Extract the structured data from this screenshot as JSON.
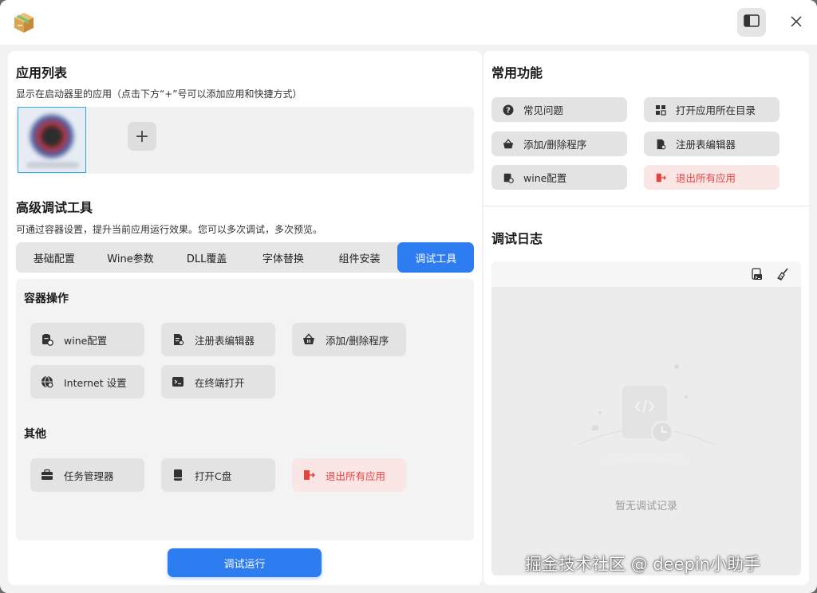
{
  "window": {
    "app_icon": "package-box-icon",
    "sidebar_toggle_icon": "sidebar-toggle-icon",
    "close_icon": "close-icon"
  },
  "left": {
    "app_list": {
      "title": "应用列表",
      "description": "显示在启动器里的应用（点击下方“+”号可以添加应用和快捷方式）",
      "add_label": "+"
    },
    "debug_tools": {
      "title": "高级调试工具",
      "description": "可通过容器设置，提升当前应用运行效果。您可以多次调试，多次预览。",
      "tabs": [
        {
          "label": "基础配置"
        },
        {
          "label": "Wine参数"
        },
        {
          "label": "DLL覆盖"
        },
        {
          "label": "字体替换"
        },
        {
          "label": "组件安装"
        },
        {
          "label": "调试工具"
        }
      ],
      "active_tab": 5
    },
    "container_ops": {
      "title": "容器操作",
      "buttons": [
        {
          "label": "wine配置",
          "icon": "wine-config-icon"
        },
        {
          "label": "注册表编辑器",
          "icon": "registry-editor-icon"
        },
        {
          "label": "添加/删除程序",
          "icon": "basket-icon"
        },
        {
          "label": "Internet 设置",
          "icon": "globe-icon"
        },
        {
          "label": "在终端打开",
          "icon": "terminal-icon"
        }
      ]
    },
    "others": {
      "title": "其他",
      "buttons": [
        {
          "label": "任务管理器",
          "icon": "toolbox-icon"
        },
        {
          "label": "打开C盘",
          "icon": "drive-icon"
        },
        {
          "label": "退出所有应用",
          "icon": "exit-icon"
        }
      ]
    },
    "run_button": "调试运行"
  },
  "right": {
    "common": {
      "title": "常用功能",
      "buttons": [
        {
          "label": "常见问题",
          "icon": "question-icon"
        },
        {
          "label": "打开应用所在目录",
          "icon": "folder-grid-icon"
        },
        {
          "label": "添加/删除程序",
          "icon": "basket-icon"
        },
        {
          "label": "注册表编辑器",
          "icon": "registry-editor-icon"
        },
        {
          "label": "wine配置",
          "icon": "wine-config-icon"
        },
        {
          "label": "退出所有应用",
          "icon": "exit-icon"
        }
      ]
    },
    "log": {
      "title": "调试日志",
      "empty_text": "暂无调试记录",
      "tools": [
        "export-log-icon",
        "clear-brush-icon"
      ]
    }
  },
  "watermark": "掘金技术社区 @ deepin小助手",
  "colors": {
    "accent": "#2d7cf0",
    "danger_text": "#e8423f",
    "danger_bg": "#fbe6e6",
    "button_bg": "#e3e3e3"
  }
}
